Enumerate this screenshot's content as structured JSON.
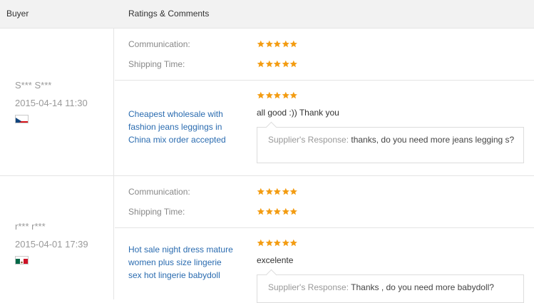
{
  "header": {
    "buyer": "Buyer",
    "ratings_comments": "Ratings & Comments"
  },
  "colors": {
    "star": "#f39c12",
    "link": "#2b6cb0"
  },
  "feedbacks": [
    {
      "buyer": "S*** S***",
      "date": "2015-04-14 11:30",
      "country_flag": "czech-republic",
      "communication_label": "Communication:",
      "communication_stars": 5,
      "shipping_label": "Shipping Time:",
      "shipping_stars": 5,
      "product": "Cheapest wholesale with fashion jeans leggings in China mix order accepted",
      "product_stars": 5,
      "comment": "all good :)) Thank you",
      "response_label": "Supplier's Response:",
      "response_text": "thanks, do you need more jeans legging s?"
    },
    {
      "buyer": "r*** r***",
      "date": "2015-04-01 17:39",
      "country_flag": "mexico",
      "communication_label": "Communication:",
      "communication_stars": 5,
      "shipping_label": "Shipping Time:",
      "shipping_stars": 5,
      "product": "Hot sale night dress mature women plus size lingerie sex hot lingerie babydoll",
      "product_stars": 5,
      "comment": "excelente",
      "response_label": "Supplier's Response:",
      "response_text": "Thanks , do you need more babydoll?"
    }
  ]
}
